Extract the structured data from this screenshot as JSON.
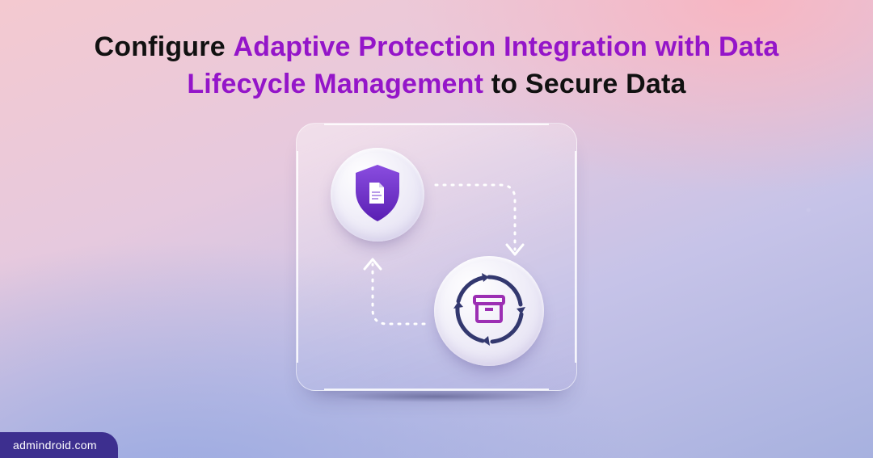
{
  "headline": {
    "prefix": "Configure ",
    "accent": "Adaptive Protection Integration with Data Lifecycle Management",
    "suffix": " to Secure Data"
  },
  "icons": {
    "shield": "shield-document-icon",
    "lifecycle": "lifecycle-archive-icon",
    "arrow_right_down": "flow-arrow-right-down",
    "arrow_left_up": "flow-arrow-left-up"
  },
  "attribution": "admindroid.com",
  "colors": {
    "accent_text": "#9415c9",
    "shield_fill_a": "#7c3ad6",
    "shield_fill_b": "#5b1fb5",
    "cycle_stroke": "#33386f",
    "box_stroke": "#9c2fb3",
    "frame": "#ffffff"
  }
}
